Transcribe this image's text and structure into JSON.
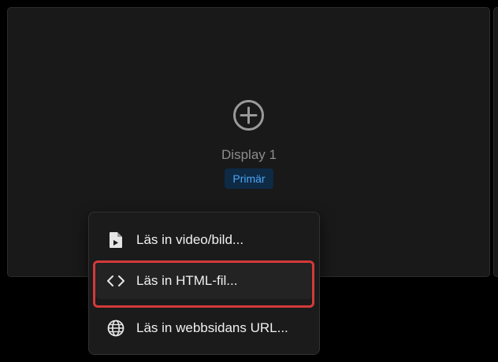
{
  "display": {
    "name": "Display 1",
    "badge": "Primär",
    "add_icon": "plus-circle-icon"
  },
  "menu": {
    "items": [
      {
        "label": "Läs in video/bild...",
        "icon": "file-media-icon"
      },
      {
        "label": "Läs in HTML-fil...",
        "icon": "code-icon"
      },
      {
        "label": "Läs in webbsidans URL...",
        "icon": "globe-icon"
      }
    ]
  },
  "colors": {
    "background": "#000000",
    "card": "#191919",
    "menu": "#1b1b1b",
    "badge_bg": "#0e2a45",
    "badge_text": "#4ea6f5",
    "highlight": "#d33a3a"
  }
}
